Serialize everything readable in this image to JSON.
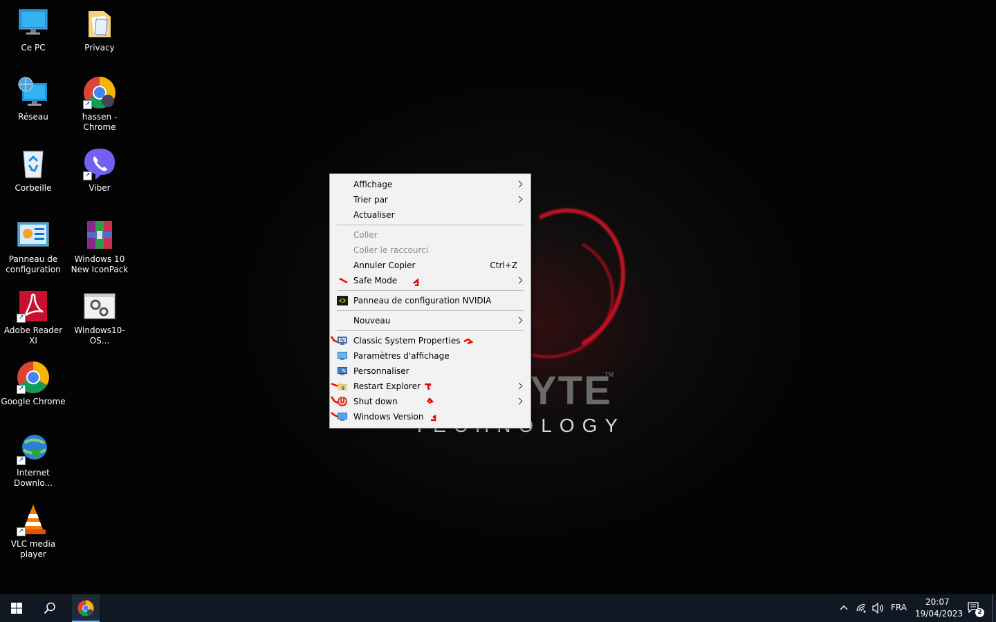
{
  "desktop": {
    "icons": [
      {
        "label": "Ce PC",
        "icon": "computer-icon"
      },
      {
        "label": "Privacy",
        "icon": "folder-document-icon"
      },
      {
        "label": "Réseau",
        "icon": "network-icon"
      },
      {
        "label": "hassen - Chrome",
        "icon": "chrome-profile-icon"
      },
      {
        "label": "Corbeille",
        "icon": "recycle-bin-icon"
      },
      {
        "label": "Viber",
        "icon": "viber-icon"
      },
      {
        "label": "Panneau de configuration",
        "icon": "control-panel-icon"
      },
      {
        "label": "Windows 10 New IconPack",
        "icon": "archive-icon"
      },
      {
        "label": "Adobe Reader XI",
        "icon": "adobe-reader-icon"
      },
      {
        "label": "Windows10-OS...",
        "icon": "settings-window-icon"
      },
      {
        "label": "Google Chrome",
        "icon": "chrome-icon"
      },
      {
        "label": "Internet Downlo...",
        "icon": "internet-download-manager-icon"
      },
      {
        "label": "VLC media player",
        "icon": "vlc-icon"
      }
    ]
  },
  "wallpaper": {
    "brand": "YTE",
    "tm": "TM",
    "subtitle": "TECHNOLOGY"
  },
  "context_menu": {
    "items": [
      {
        "label": "Affichage",
        "submenu": true
      },
      {
        "label": "Trier par",
        "submenu": true
      },
      {
        "label": "Actualiser"
      },
      {
        "label": "Coller",
        "disabled": true
      },
      {
        "label": "Coller le raccourci",
        "disabled": true
      },
      {
        "label": "Annuler Copier",
        "shortcut": "Ctrl+Z"
      },
      {
        "label": "Safe Mode",
        "submenu": true
      },
      {
        "label": "Panneau de configuration NVIDIA",
        "icon": "nvidia-icon"
      },
      {
        "label": "Nouveau",
        "submenu": true
      },
      {
        "label": "Classic System Properties",
        "icon": "system-properties-icon"
      },
      {
        "label": "Paramètres d'affichage",
        "icon": "display-settings-icon"
      },
      {
        "label": "Personnaliser",
        "icon": "personalize-icon"
      },
      {
        "label": "Restart Explorer",
        "icon": "explorer-icon",
        "submenu": true
      },
      {
        "label": "Shut down",
        "icon": "power-icon",
        "submenu": true
      },
      {
        "label": "Windows Version",
        "icon": "monitor-icon"
      }
    ]
  },
  "taskbar": {
    "language": "FRA",
    "time": "20:07",
    "date": "19/04/2023",
    "notification_count": "2",
    "colors": {
      "background": "#101824",
      "active_underline": "#76b9ed"
    }
  }
}
